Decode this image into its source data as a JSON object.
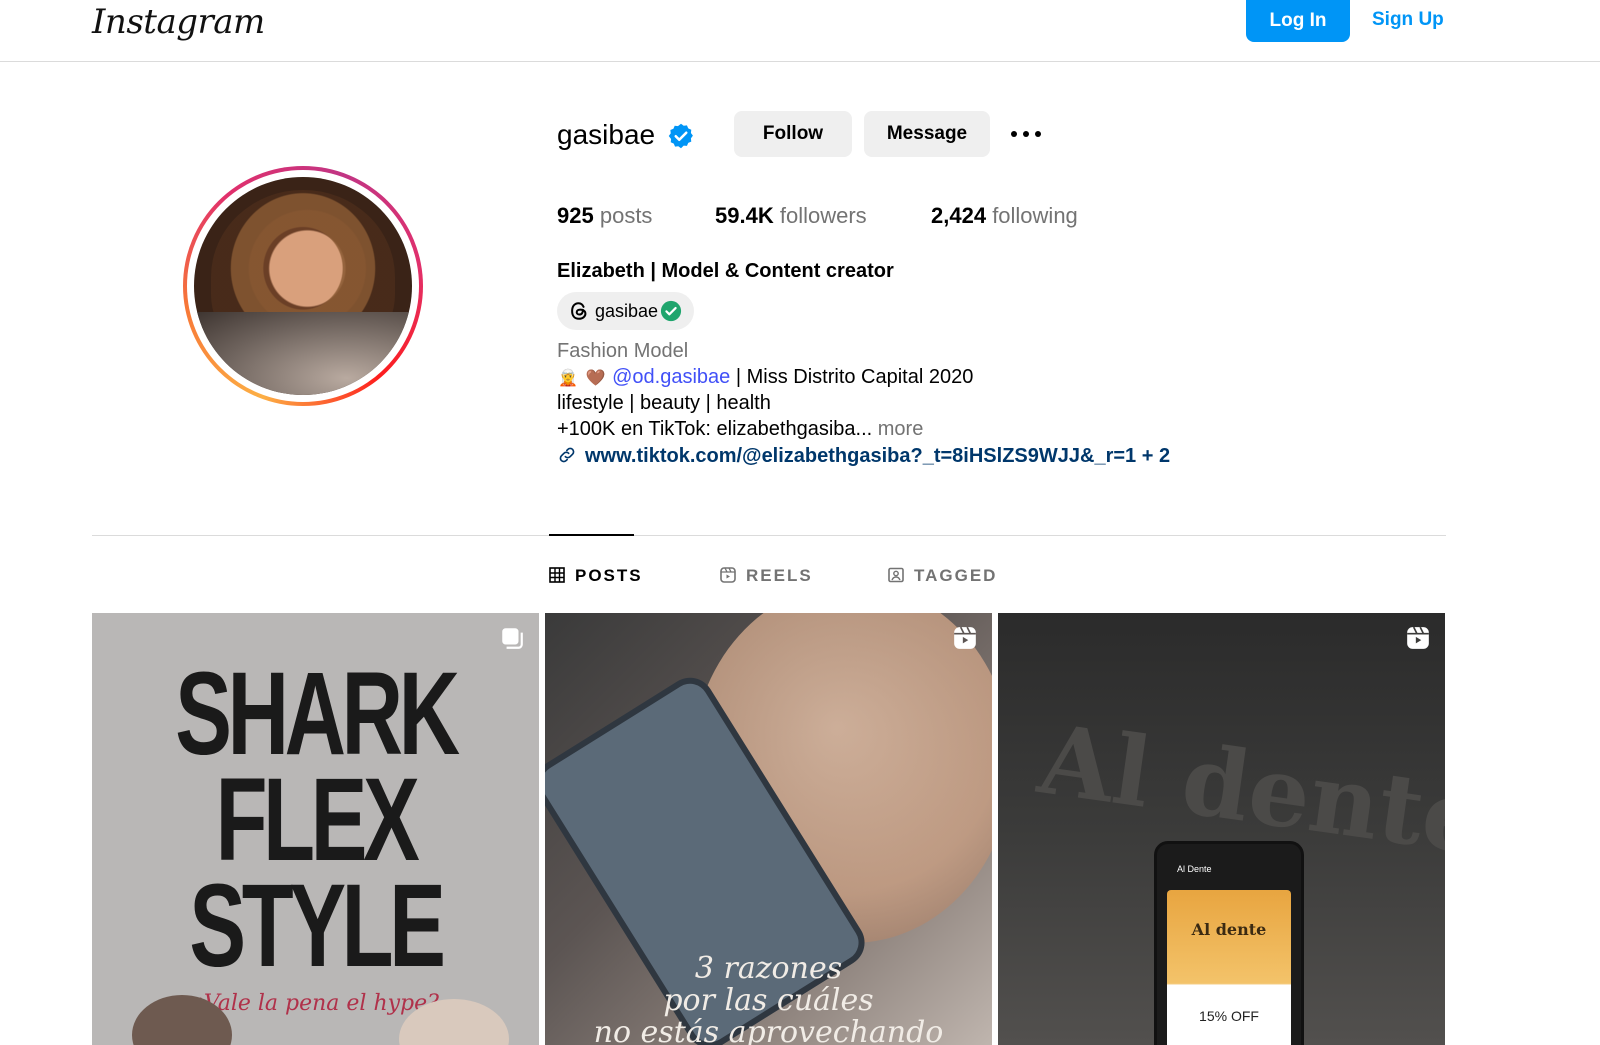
{
  "header": {
    "logo": "Instagram",
    "login_label": "Log In",
    "signup_label": "Sign Up"
  },
  "profile": {
    "username": "gasibae",
    "follow_label": "Follow",
    "message_label": "Message",
    "stats": {
      "posts_count": "925",
      "posts_label": "posts",
      "followers_count": "59.4K",
      "followers_label": "followers",
      "following_count": "2,424",
      "following_label": "following"
    },
    "full_name": "Elizabeth | Model & Content creator",
    "threads_handle": "gasibae",
    "category": "Fashion Model",
    "bio": {
      "line1_emojis": [
        "🧝",
        "🤎"
      ],
      "line1_mention": "@od.gasibae",
      "line1_rest": " | Miss Distrito Capital 2020",
      "line2": "lifestyle | beauty | health",
      "line3": "+100K en TikTok: elizabethgasiba...",
      "more_label": " more"
    },
    "website": "www.tiktok.com/@elizabethgasiba?_t=8iHSlZS9WJJ&_r=1 + 2"
  },
  "tabs": [
    {
      "label": "POSTS",
      "icon": "grid-icon",
      "active": true
    },
    {
      "label": "REELS",
      "icon": "reels-icon",
      "active": false
    },
    {
      "label": "TAGGED",
      "icon": "tagged-icon",
      "active": false
    }
  ],
  "posts": [
    {
      "type": "carousel",
      "title": "SHARK\nFLEX\nSTYLE",
      "subtitle": "¿Vale la pena el hype?"
    },
    {
      "type": "reel",
      "caption": "3 razones\npor las cuáles\nno estás aprovechando"
    },
    {
      "type": "reel",
      "bg_text": "Al dente",
      "screen_header": "Al Dente",
      "screen_title": "Al dente",
      "offer": "15% OFF"
    }
  ],
  "colors": {
    "accent": "#0095f6",
    "mention": "#4150f7",
    "link": "#00376b",
    "muted": "#737373",
    "button_bg": "#efefef",
    "verified": "#0095f6"
  }
}
